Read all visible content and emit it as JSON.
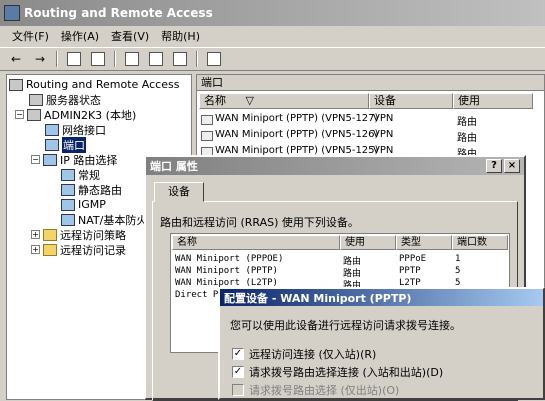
{
  "window": {
    "title": "Routing and Remote Access"
  },
  "menu": [
    "文件(F)",
    "操作(A)",
    "查看(V)",
    "帮助(H)"
  ],
  "toolbar": {
    "back": "←",
    "forward": "→"
  },
  "tree": {
    "root": "Routing and Remote Access",
    "items": [
      "服务器状态",
      "ADMIN2K3 (本地)",
      "网络接口",
      "端口",
      "IP 路由选择",
      "常规",
      "静态路由",
      "IGMP",
      "NAT/基本防火",
      "远程访问策略",
      "远程访问记录"
    ]
  },
  "ports_pane": {
    "title": "端口",
    "columns": [
      "名称",
      "设备",
      "使用"
    ],
    "sort_arrow": "▽",
    "rows": [
      {
        "name": "WAN Miniport (PPTP) (VPN5-127)",
        "device": "VPN",
        "usage": "路由"
      },
      {
        "name": "WAN Miniport (PPTP) (VPN5-126)",
        "device": "VPN",
        "usage": "路由"
      },
      {
        "name": "WAN Miniport (PPTP) (VPN5-125)",
        "device": "VPN",
        "usage": "路由"
      }
    ]
  },
  "properties_dialog": {
    "title": "端口 属性",
    "help": "?",
    "close": "×",
    "tab": "设备",
    "description": "路由和远程访问 (RRAS) 使用下列设备。",
    "columns": [
      "名称",
      "使用",
      "类型",
      "端口数"
    ],
    "rows": [
      {
        "name": "WAN Miniport (PPPOE)",
        "usage": "路由",
        "type": "PPPoE",
        "ports": "1"
      },
      {
        "name": "WAN Miniport (PPTP)",
        "usage": "路由",
        "type": "PPTP",
        "ports": "5"
      },
      {
        "name": "WAN Miniport (L2TP)",
        "usage": "路由",
        "type": "L2TP",
        "ports": "5"
      },
      {
        "name": "Direct P",
        "usage": "",
        "type": "",
        "ports": ""
      }
    ]
  },
  "configure_dialog": {
    "title": "配置设备 - WAN Miniport (PPTP)",
    "text": "您可以使用此设备进行远程访问请求拨号连接。",
    "options": [
      {
        "label": "远程访问连接 (仅入站)(R)",
        "checked": true,
        "enabled": true
      },
      {
        "label": "请求拨号路由选择连接 (入站和出站)(D)",
        "checked": true,
        "enabled": true
      },
      {
        "label": "请求拨号路由选择 (仅出站)(O)",
        "checked": false,
        "enabled": false
      }
    ],
    "check_mark": "✓"
  }
}
